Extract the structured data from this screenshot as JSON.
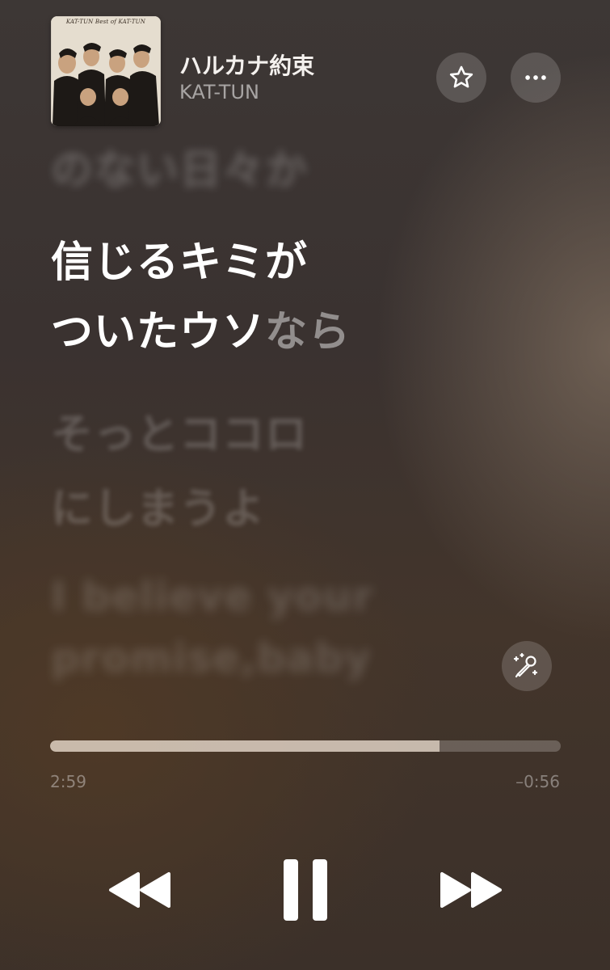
{
  "header": {
    "album_art": {
      "caption": "KAT-TUN   Best of KAT-TUN"
    },
    "title": "ハルカナ約束",
    "artist": "KAT-TUN",
    "buttons": [
      "star-icon",
      "more-icon"
    ]
  },
  "lyrics": {
    "previous": "のない日々か",
    "current_line1": "信じるキミが",
    "current_line2_sung": "ついたウソ",
    "current_line2_pending": "なら",
    "next_line1": "そっとココロ",
    "next_line2": "にしまうよ",
    "next2_line1": "I believe your",
    "next2_line2": "promise,baby"
  },
  "playback": {
    "elapsed": "2:59",
    "remaining": "–0:56",
    "progress_fraction": 0.762
  },
  "controls": {
    "icons": [
      "rewind-icon",
      "pause-icon",
      "fast-forward-icon",
      "sing-microphone-icon"
    ]
  },
  "colors": {
    "accent_text": "#ffffff",
    "secondary_text": "rgba(255,255,255,0.55)"
  }
}
